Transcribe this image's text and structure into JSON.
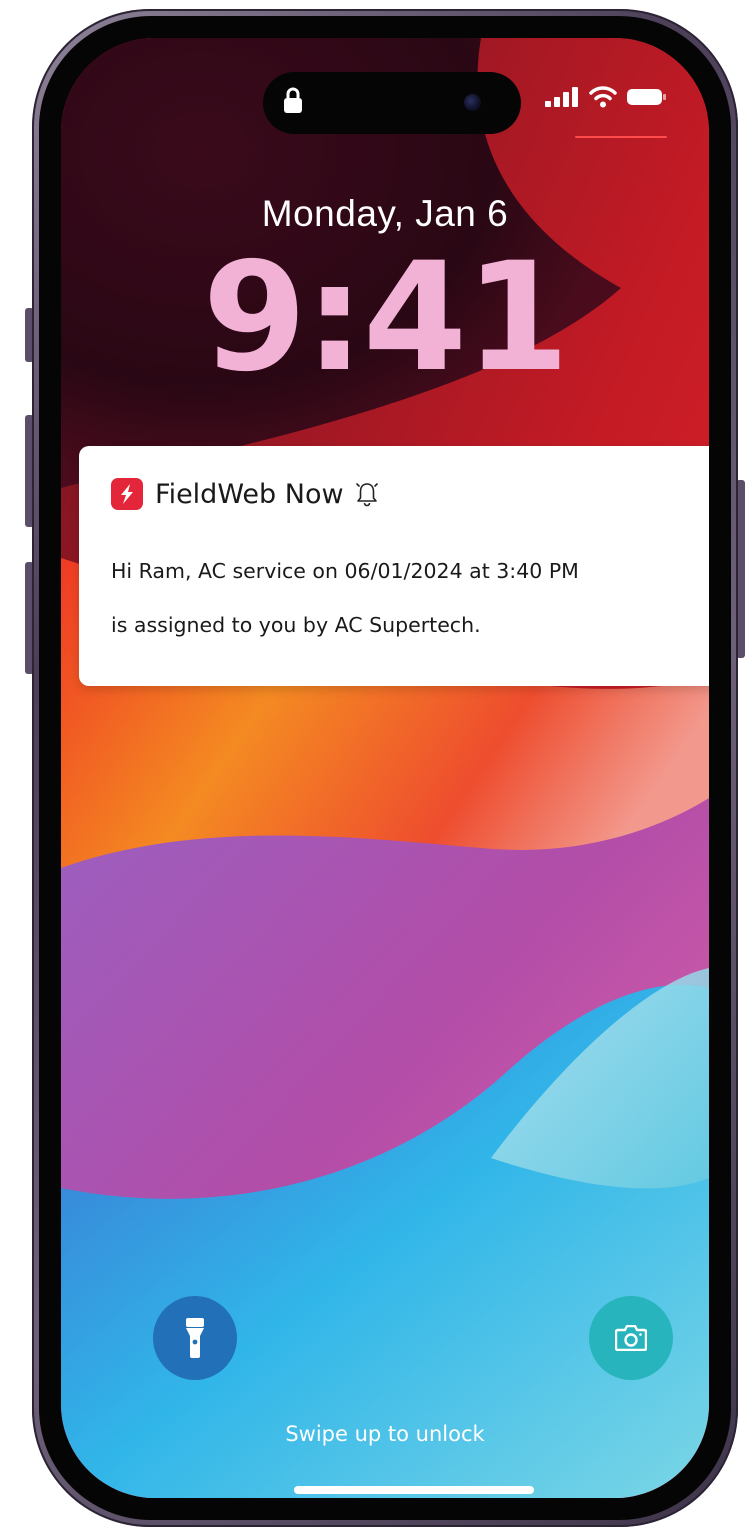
{
  "lockscreen": {
    "date": "Monday, Jan 6",
    "time": "9:41",
    "swipe_hint": "Swipe up to unlock"
  },
  "notification": {
    "app_name": "FieldWeb Now",
    "line1": "Hi Ram, AC service on 06/01/2024 at 3:40 PM",
    "line2": "is assigned to you by AC Supertech."
  },
  "status_bar": {
    "icons": [
      "signal-icon",
      "wifi-icon",
      "battery-icon"
    ]
  },
  "buttons": {
    "left": "flashlight-icon",
    "right": "camera-icon"
  },
  "colors": {
    "time": "#f1b2d5",
    "app_icon": "#e3263a",
    "flashlight_button": "#2170b8",
    "camera_button": "#28b4bd"
  }
}
